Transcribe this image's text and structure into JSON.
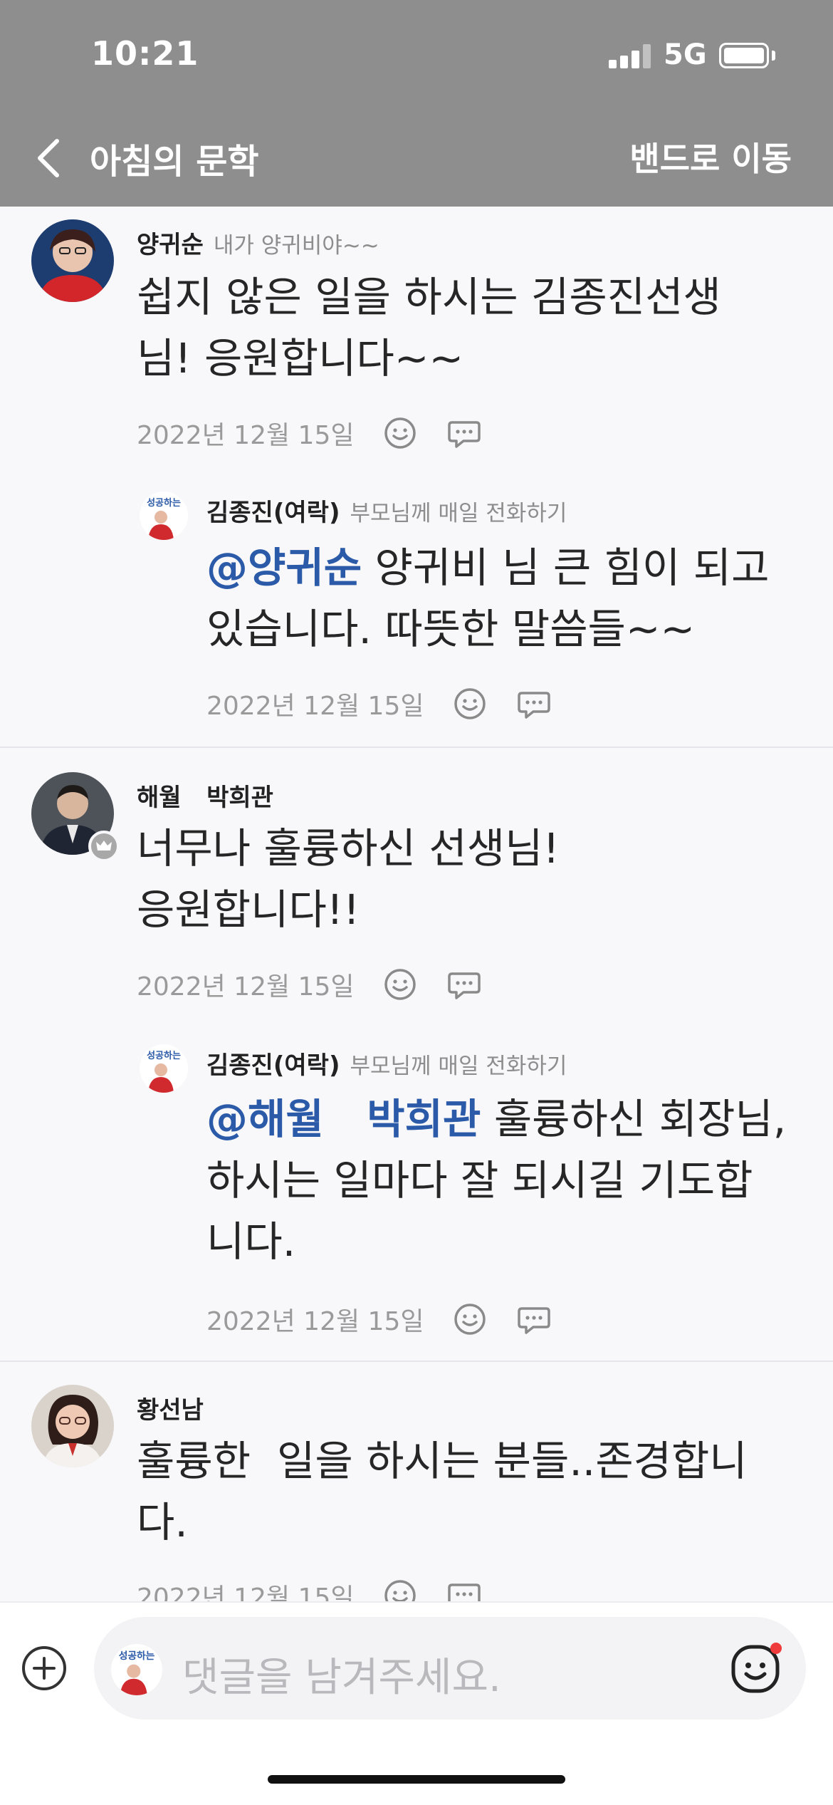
{
  "status_bar": {
    "time": "10:21",
    "network": "5G"
  },
  "header": {
    "title": "아침의 문학",
    "action_label": "밴드로 이동"
  },
  "comments": [
    {
      "name": "양귀순",
      "subtitle": "내가 양귀비야~~",
      "lines": [
        "쉽지 않은 일을 하시는 김종진선생",
        "님!  응원합니다~~"
      ],
      "date": "2022년 12월 15일",
      "reply": {
        "name": "김종진(여락)",
        "subtitle": "부모님께 매일 전화하기",
        "mention": "@양귀순",
        "line1_rest": " 양귀비 님 큰 힘이 되고",
        "line2": "있습니다. 따뜻한 말씀들~~",
        "date": "2022년 12월 15일"
      }
    },
    {
      "name": "해월   박희관",
      "subtitle": "",
      "lines": [
        "너무나 훌륭하신 선생님!",
        "응원합니다!!"
      ],
      "date": "2022년 12월 15일",
      "reply": {
        "name": "김종진(여락)",
        "subtitle": "부모님께 매일 전화하기",
        "mention": "@해월   박희관",
        "line1_rest": " 훌륭하신 회장님,",
        "line2": "하시는 일마다 잘 되시길 기도합",
        "line3": "니다.",
        "date": "2022년 12월 15일"
      }
    },
    {
      "name": "황선남",
      "subtitle": "",
      "lines": [
        "훌륭한  일을 하시는 분들..존경합니",
        "다."
      ],
      "date": "2022년 12월 15일"
    }
  ],
  "composer": {
    "placeholder": "댓글을 남겨주세요."
  },
  "icons": {
    "back": "chevron-left-icon",
    "reaction": "smiley-icon",
    "reply": "speech-bubble-icon",
    "add": "plus-circle-icon",
    "sticker": "smiley-sticker-icon",
    "crown": "crown-badge-icon"
  },
  "colors": {
    "header_bg": "#8e8e8e",
    "mention": "#2b5aa8",
    "notification_dot": "#ef3b3b"
  }
}
